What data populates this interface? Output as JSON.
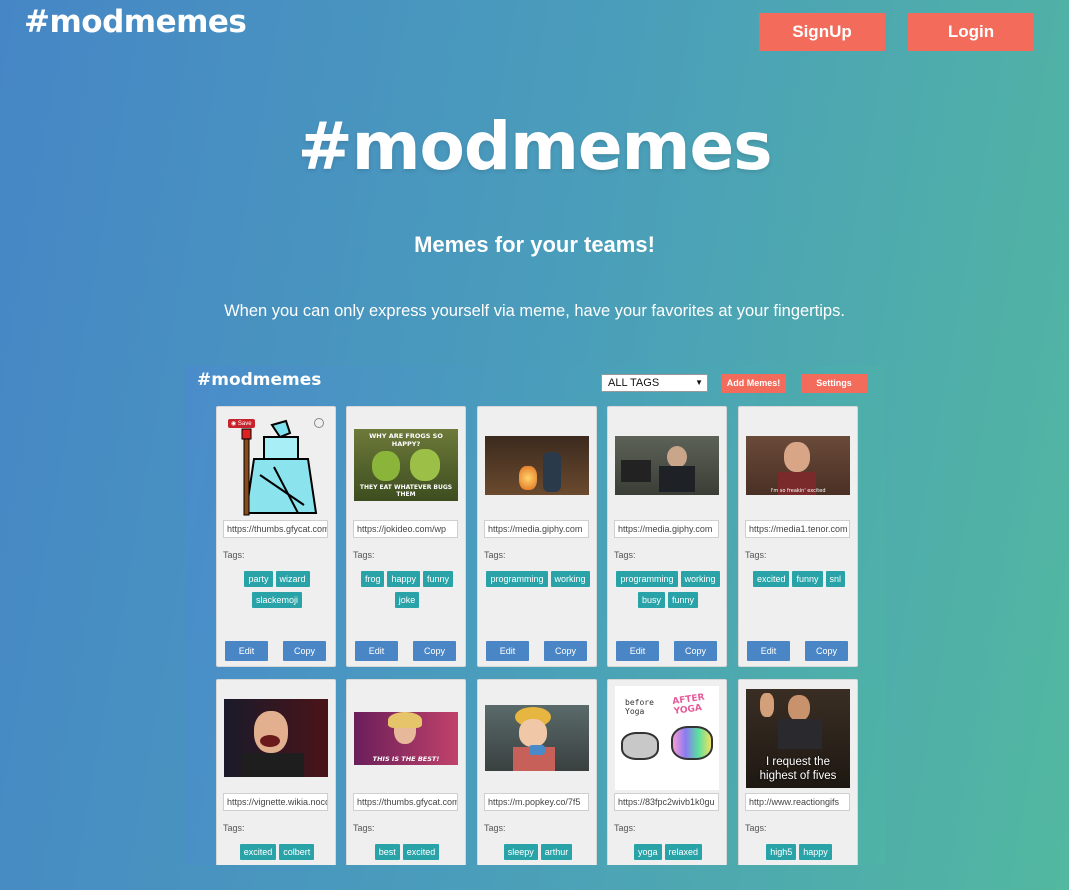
{
  "nav": {
    "brand": "#modmemes",
    "signup": "SignUp",
    "login": "Login"
  },
  "hero": {
    "title": "#modmemes",
    "subtitle": "Memes for your teams!",
    "description": "When you can only express yourself via meme, have your favorites at your fingertips."
  },
  "preview": {
    "brand": "#modmemes",
    "tag_filter": "ALL TAGS",
    "add_button": "Add Memes!",
    "settings_button": "Settings",
    "tags_label": "Tags:",
    "edit_label": "Edit",
    "copy_label": "Copy",
    "save_badge": "Save",
    "cards": [
      {
        "url": "https://thumbs.gfycat.com",
        "tags": [
          "party",
          "wizard",
          "slackemoji"
        ],
        "image": "pixel-wizard"
      },
      {
        "url": "https://jokideo.com/wp",
        "tags": [
          "frog",
          "happy",
          "funny",
          "joke"
        ],
        "image": "frogs",
        "caption_top": "WHY ARE FROGS SO HAPPY?",
        "caption_bottom": "THEY EAT WHATEVER BUGS THEM"
      },
      {
        "url": "https://media.giphy.com",
        "tags": [
          "programming",
          "working"
        ],
        "image": "office-fire"
      },
      {
        "url": "https://media.giphy.com",
        "tags": [
          "programming",
          "working",
          "busy",
          "funny"
        ],
        "image": "typing"
      },
      {
        "url": "https://media1.tenor.com",
        "tags": [
          "excited",
          "funny",
          "snl"
        ],
        "image": "snl-guy",
        "caption_bottom": "I'm so freakin' excited"
      },
      {
        "url": "https://vignette.wikia.nocookie",
        "tags": [
          "excited",
          "colbert"
        ],
        "image": "colbert"
      },
      {
        "url": "https://thumbs.gfycat.com",
        "tags": [
          "best",
          "excited"
        ],
        "image": "excited-woman",
        "caption_bottom": "THIS IS THE BEST!"
      },
      {
        "url": "https://m.popkey.co/7f5",
        "tags": [
          "sleepy",
          "arthur"
        ],
        "image": "cartoon-boy"
      },
      {
        "url": "https://83fpc2wivb1k0gu",
        "tags": [
          "yoga",
          "relaxed"
        ],
        "image": "unicorn",
        "caption_before": "before Yoga",
        "caption_after": "AFTER YOGA"
      },
      {
        "url": "http://www.reactiongifs",
        "tags": [
          "high5",
          "happy"
        ],
        "image": "high-five",
        "caption_bottom": "I request the highest of fives"
      }
    ]
  }
}
